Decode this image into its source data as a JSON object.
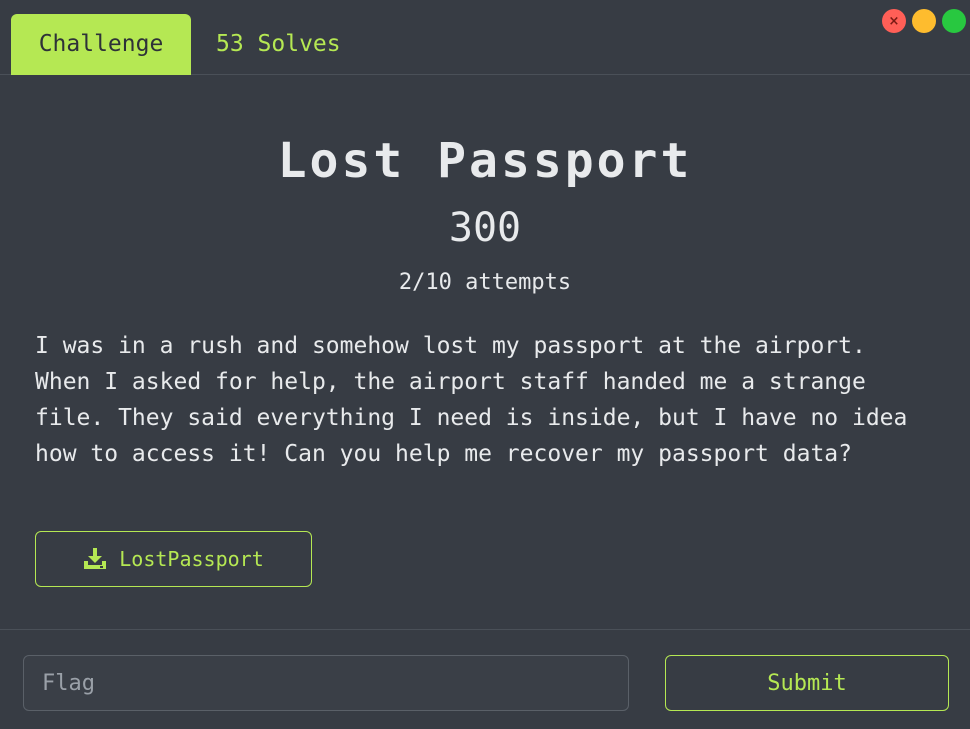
{
  "tabs": {
    "challenge_label": "Challenge",
    "solves_label": "53 Solves"
  },
  "window_controls": {
    "close_glyph": "×"
  },
  "challenge": {
    "title": "Lost Passport",
    "points": "300",
    "attempts": "2/10 attempts",
    "description": "I was in a rush and somehow lost my passport at the airport. When I asked for help, the airport staff handed me a strange file. They said everything I need is inside, but I have no idea how to access it! Can you help me recover my passport data?",
    "file_label": "LostPassport",
    "file_icon": "download-icon"
  },
  "form": {
    "flag_placeholder": "Flag",
    "flag_value": "",
    "submit_label": "Submit"
  },
  "colors": {
    "accent": "#b5e853",
    "background": "#373c44",
    "text": "#e8eaec"
  }
}
